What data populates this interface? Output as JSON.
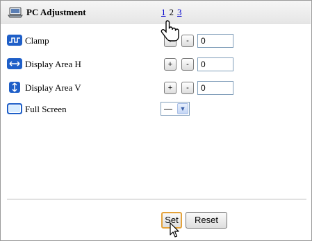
{
  "header": {
    "icon": "pc-adjustment-icon",
    "title": "PC Adjustment",
    "pages": [
      "1",
      "2",
      "3"
    ]
  },
  "rows": [
    {
      "icon": "clamp-icon",
      "label": "Clamp",
      "plus": "+",
      "minus": "-",
      "value": "0"
    },
    {
      "icon": "display-area-h-icon",
      "label": "Display Area H",
      "plus": "+",
      "minus": "-",
      "value": "0"
    },
    {
      "icon": "display-area-v-icon",
      "label": "Display Area V",
      "plus": "+",
      "minus": "-",
      "value": "0"
    },
    {
      "icon": "full-screen-icon",
      "label": "Full Screen",
      "select_value": "—"
    }
  ],
  "footer": {
    "set_label": "Set",
    "reset_label": "Reset"
  },
  "colors": {
    "icon_blue": "#1f5fc8",
    "link": "#0000cc",
    "focus_border": "#e4a23a"
  }
}
